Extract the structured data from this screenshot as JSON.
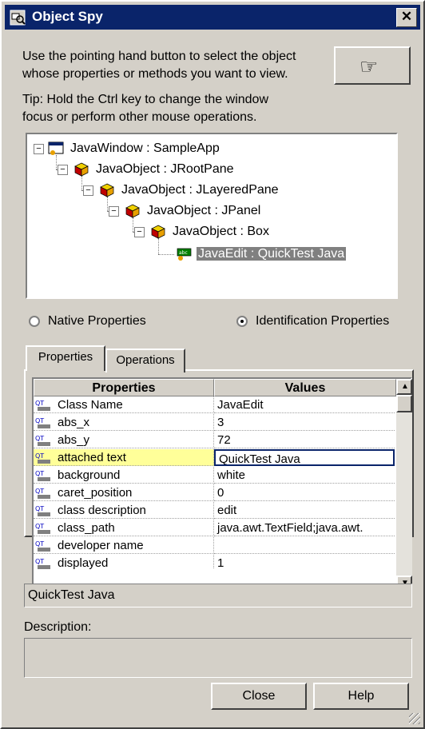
{
  "window": {
    "title": "Object Spy",
    "close_label": "✕"
  },
  "instructions": {
    "line1": "Use the pointing hand button to select the object",
    "line2": "whose properties or methods you want to view.",
    "tip1": "Tip: Hold the Ctrl key to change the window",
    "tip2": "focus or perform other mouse operations.",
    "hand_glyph": "☞"
  },
  "tree": {
    "nodes": [
      {
        "label": "JavaWindow : SampleApp",
        "icon": "java-window-icon"
      },
      {
        "label": "JavaObject : JRootPane",
        "icon": "java-object-icon"
      },
      {
        "label": "JavaObject : JLayeredPane",
        "icon": "java-object-icon"
      },
      {
        "label": "JavaObject : JPanel",
        "icon": "java-object-icon"
      },
      {
        "label": "JavaObject : Box",
        "icon": "java-object-icon"
      },
      {
        "label": "JavaEdit : QuickTest Java",
        "icon": "java-edit-icon",
        "selected": true
      }
    ]
  },
  "radios": {
    "native": {
      "label": "Native Properties",
      "checked": false
    },
    "identification": {
      "label": "Identification Properties",
      "checked": true
    }
  },
  "tabs": {
    "properties": "Properties",
    "operations": "Operations"
  },
  "grid": {
    "headers": {
      "name": "Properties",
      "value": "Values"
    },
    "rows": [
      {
        "name": "Class Name",
        "value": "JavaEdit"
      },
      {
        "name": "abs_x",
        "value": "3"
      },
      {
        "name": "abs_y",
        "value": "72"
      },
      {
        "name": "attached text",
        "value": "QuickTest Java",
        "highlighted": true
      },
      {
        "name": "background",
        "value": "white"
      },
      {
        "name": "caret_position",
        "value": "0"
      },
      {
        "name": "class description",
        "value": "edit"
      },
      {
        "name": "class_path",
        "value": "java.awt.TextField;java.awt."
      },
      {
        "name": "developer name",
        "value": ""
      },
      {
        "name": "displayed",
        "value": "1"
      }
    ]
  },
  "value_field": "QuickTest Java",
  "description_label": "Description:",
  "description_value": "",
  "buttons": {
    "close": "Close",
    "help": "Help"
  },
  "colors": {
    "title_bar": "#0a246a",
    "face": "#d4d0c8",
    "highlight_row": "#ffff99"
  }
}
